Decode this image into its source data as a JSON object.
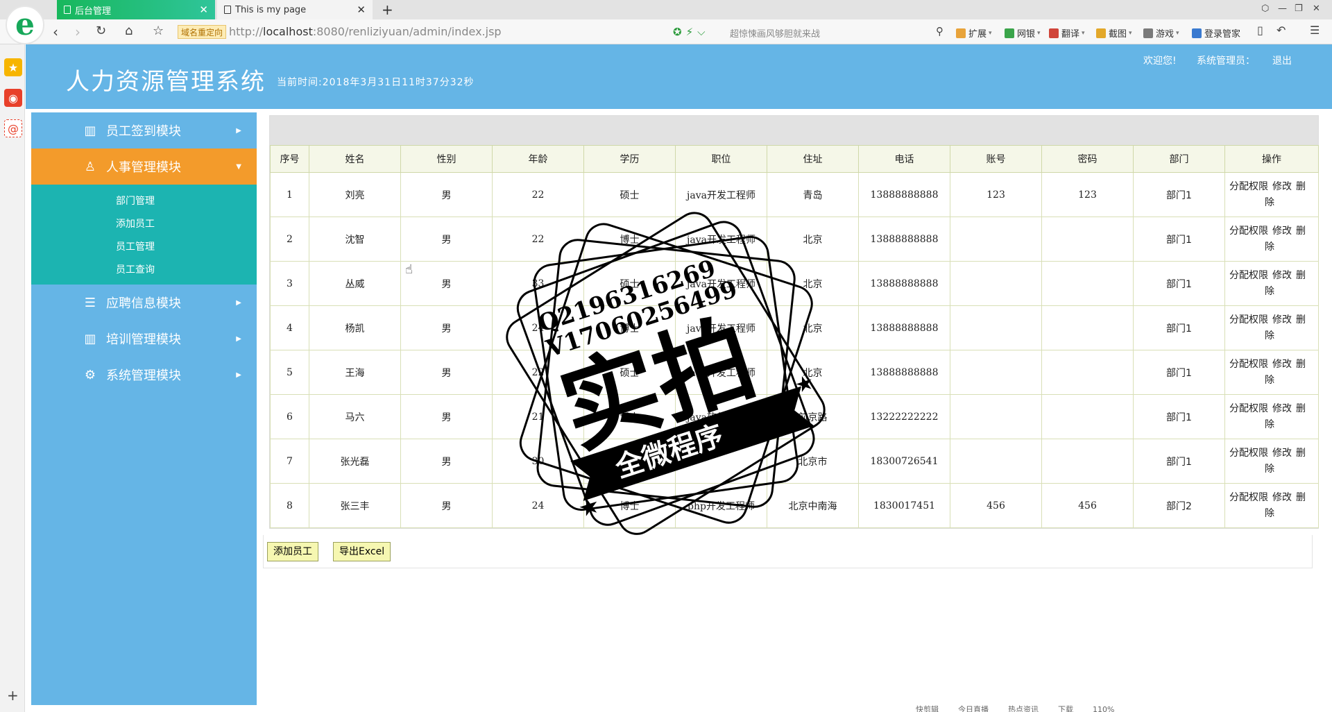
{
  "browser": {
    "tabs": [
      {
        "label": "后台管理",
        "active": true
      },
      {
        "label": "This is my page",
        "active": false
      }
    ],
    "new_tab_symbol": "+",
    "redirect_badge": "域名重定向",
    "url_prefix": "http://",
    "url_host": "localhost",
    "url_rest": ":8080/renliziyuan/admin/index.jsp",
    "search_hint": "超惊悚画风够胆就来战",
    "tools": [
      {
        "label": "扩展",
        "color": "#e8a33a"
      },
      {
        "label": "网银",
        "color": "#3aa44a"
      },
      {
        "label": "翻译",
        "color": "#d0453a"
      },
      {
        "label": "截图",
        "color": "#e3a82a"
      },
      {
        "label": "游戏",
        "color": "#7a7a7a"
      },
      {
        "label": "登录管家",
        "color": "#3a7ad0"
      }
    ]
  },
  "header": {
    "title": "人力资源管理系统",
    "current_time": "当前时间:2018年3月31日11时37分32秒",
    "welcome": "欢迎您!",
    "role": "系统管理员：",
    "logout": "退出",
    "bg_color": "#65b5e6"
  },
  "sidebar": {
    "modules": [
      {
        "label": "员工签到模块",
        "icon": "notebook-icon",
        "expanded": false
      },
      {
        "label": "人事管理模块",
        "icon": "user-settings-icon",
        "expanded": true
      },
      {
        "label": "应聘信息模块",
        "icon": "stack-icon",
        "expanded": false
      },
      {
        "label": "培训管理模块",
        "icon": "notebook-icon",
        "expanded": false
      },
      {
        "label": "系统管理模块",
        "icon": "gear-icon",
        "expanded": false
      }
    ],
    "submenu": [
      "部门管理",
      "添加员工",
      "员工管理",
      "员工查询"
    ],
    "active_color": "#f39b2b",
    "submenu_color": "#1cb4b1"
  },
  "table": {
    "columns": [
      "序号",
      "姓名",
      "性别",
      "年龄",
      "学历",
      "职位",
      "住址",
      "电话",
      "账号",
      "密码",
      "部门",
      "操作"
    ],
    "rows": [
      [
        "1",
        "刘亮",
        "男",
        "22",
        "硕士",
        "java开发工程师",
        "青岛",
        "13888888888",
        "123",
        "123",
        "部门1"
      ],
      [
        "2",
        "沈智",
        "男",
        "22",
        "博士",
        "java开发工程师",
        "北京",
        "13888888888",
        "",
        "",
        "部门1"
      ],
      [
        "3",
        "丛威",
        "男",
        "33",
        "硕士",
        "java开发工程师",
        "北京",
        "13888888888",
        "",
        "",
        "部门1"
      ],
      [
        "4",
        "杨凯",
        "男",
        "24",
        "博士",
        "java开发工程师",
        "北京",
        "13888888888",
        "",
        "",
        "部门1"
      ],
      [
        "5",
        "王海",
        "男",
        "22",
        "硕士",
        "java开发工程师",
        "北京",
        "13888888888",
        "",
        "",
        "部门1"
      ],
      [
        "6",
        "马六",
        "男",
        "21",
        "博士",
        "java软件工程师",
        "前京路",
        "13222222222",
        "",
        "",
        "部门1"
      ],
      [
        "7",
        "张光磊",
        "男",
        "30",
        "",
        "",
        "北京市",
        "18300726541",
        "",
        "",
        "部门1"
      ],
      [
        "8",
        "张三丰",
        "男",
        "24",
        "博士",
        "php开发工程师",
        "北京中南海",
        "1830017451",
        "456",
        "456",
        "部门2"
      ]
    ],
    "ops": {
      "assign": "分配权限",
      "edit": "修改",
      "delete_part1": "删",
      "delete_part2": "除"
    }
  },
  "actions": {
    "add_employee": "添加员工",
    "export_excel": "导出Excel"
  },
  "watermark": {
    "line1": "Q2196316269",
    "line2": "V17060256499",
    "main": "实拍",
    "ribbon": "全微程序"
  },
  "statusbar": [
    "快剪辑",
    "今日直播",
    "热点资讯",
    "下载",
    "110%"
  ]
}
